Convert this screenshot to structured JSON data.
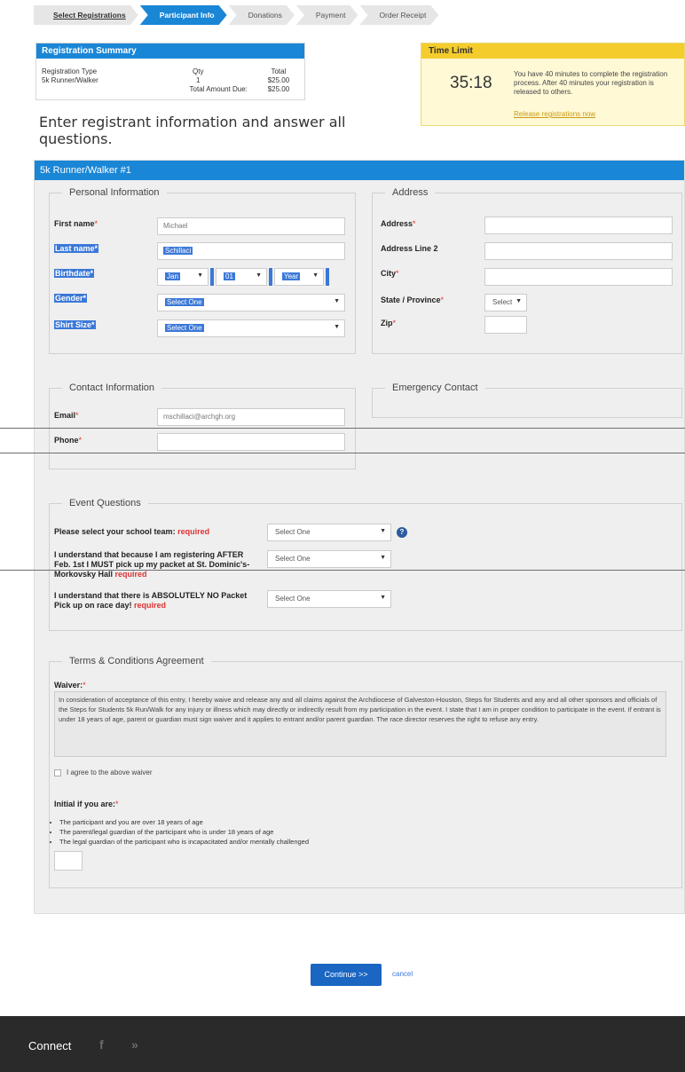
{
  "steps": [
    {
      "label": "Select Registrations",
      "state": "done"
    },
    {
      "label": "Participant Info",
      "state": "active"
    },
    {
      "label": "Donations",
      "state": "todo"
    },
    {
      "label": "Payment",
      "state": "todo"
    },
    {
      "label": "Order Receipt",
      "state": "todo"
    }
  ],
  "summary": {
    "title": "Registration Summary",
    "col_type": "Registration Type",
    "col_qty": "Qty",
    "col_total": "Total",
    "row_type": "5k Runner/Walker",
    "row_qty": "1",
    "row_total": "$25.00",
    "due_label": "Total Amount Due:",
    "due_value": "$25.00"
  },
  "time_limit": {
    "title": "Time Limit",
    "countdown": "35:18",
    "message": "You have 40 minutes to complete the registration process. After 40 minutes your registration is released to others.",
    "release_link": "Release registrations now"
  },
  "instructions": "Enter registrant information and answer all questions.",
  "panel_title": "5k Runner/Walker #1",
  "personal": {
    "legend": "Personal Information",
    "first_name_label": "First name",
    "first_name_value": "Michael",
    "last_name_label": "Last name*",
    "last_name_value": "Schillaci",
    "birthdate_label": "Birthdate*",
    "birth_month": "Jan",
    "birth_day": "01",
    "birth_year": "Year",
    "gender_label": "Gender*",
    "gender_value": "Select One",
    "shirt_label": "Shirt Size*",
    "shirt_value": "Select One",
    "required_mark": "*"
  },
  "address": {
    "legend": "Address",
    "address_label": "Address",
    "address2_label": "Address Line 2",
    "city_label": "City",
    "state_label": "State / Province",
    "state_value": "Select",
    "zip_label": "Zip"
  },
  "contact": {
    "legend": "Contact Information",
    "email_label": "Email",
    "email_value": "mschillaci@archgh.org",
    "phone_label": "Phone"
  },
  "emergency": {
    "legend": "Emergency Contact"
  },
  "questions": {
    "legend": "Event Questions",
    "required_word": "required",
    "q1": "Please select your school team:",
    "q1_value": "Select One",
    "q2": "I understand that because I am registering AFTER Feb. 1st I MUST pick up my packet at St. Dominic's- Morkovsky Hall",
    "q2_value": "Select One",
    "q3": "I understand that there is ABSOLUTELY NO Packet Pick up on race day!",
    "q3_value": "Select One",
    "help_icon": "?"
  },
  "terms": {
    "legend": "Terms & Conditions Agreement",
    "waiver_label": "Waiver:",
    "waiver_text": "In consideration of acceptance of this entry, I hereby waive and release any and all claims against the Archdiocese of Galveston-Houston, Steps for Students and any and all other sponsors and officials of the Steps for Students 5k Run/Walk for any injury or illness which may directly or indirectly result from my participation in the event.  I state that I am in proper condition to participate in the event.  If entrant is under 18 years of age, parent or guardian must sign waiver and it applies to entrant and/or parent guardian.  The race director reserves the right to refuse any entry.",
    "agree_label": "I agree to the above waiver",
    "initial_label": "Initial if you are:",
    "initial_items": [
      "The participant and you are over 18 years of age",
      "The parent/legal guardian of the participant who is under 18 years of age",
      "The legal guardian of the participant who is incapacitated and/or mentally challenged"
    ]
  },
  "actions": {
    "continue": "Continue >>",
    "cancel": "cancel"
  },
  "footer": {
    "connect": "Connect",
    "facebook_glyph": "f",
    "twitter_glyph": "»"
  },
  "colors": {
    "primary": "#1a86d6",
    "highlight": "#3b78d8",
    "required": "#d33333",
    "timer_header": "#f4cd2c",
    "footer": "#2a2a2a"
  }
}
